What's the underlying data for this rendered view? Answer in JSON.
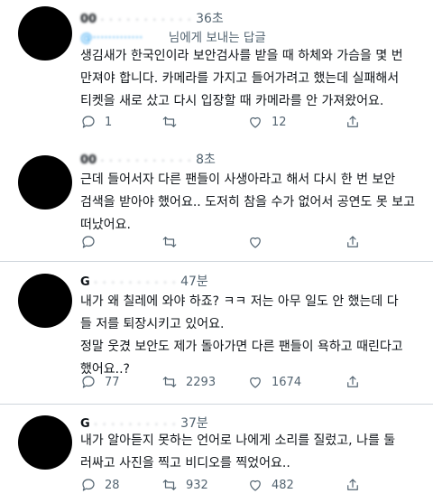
{
  "tweets": [
    {
      "handle_blurred": "@",
      "time": "36초",
      "reply_prefix": "@",
      "reply_text": "님에게 보내는 답글",
      "lines": [
        "생김새가 한국인이라 보안검사를 받을 때 하체와 가슴을 몇 번",
        "만져야 합니다. 카메라를 가지고 들어가려고 했는데 실패해서",
        "티켓을 새로 샀고 다시 입장할 때 카메라를 안 가져왔어요."
      ],
      "replies": "1",
      "retweets": "",
      "likes": "12",
      "icons": [
        "reply-icon",
        "retweet-icon",
        "like-icon",
        "share-icon"
      ]
    },
    {
      "handle_blurred": "",
      "time": "8초",
      "lines": [
        "근데 들어서자 다른 팬들이 사생아라고 해서 다시 한 번 보안",
        "검색을 받아야 했어요.. 도저히 참을 수가 없어서 공연도 못 보고",
        "떠났어요."
      ],
      "replies": "",
      "retweets": "",
      "likes": "",
      "icons": [
        "reply-icon",
        "retweet-icon",
        "like-icon",
        "share-icon"
      ]
    },
    {
      "handle_blurred": "G",
      "time": "47분",
      "lines": [
        "내가 왜 칠레에 와야 하죠? ㅋㅋ 저는 아무 일도 안 했는데 다",
        "들 저를 퇴장시키고 있어요.",
        "정말 웃겼 보안도 제가 돌아가면 다른 팬들이 욕하고 때린다고",
        "했어요..?"
      ],
      "replies": "77",
      "retweets": "2293",
      "likes": "1674",
      "icons": [
        "reply-icon",
        "retweet-icon",
        "like-icon",
        "share-icon"
      ]
    },
    {
      "handle_blurred": "G",
      "time": "37분",
      "lines": [
        "내가 알아듣지 못하는 언어로 나에게 소리를 질렀고, 나를 둘",
        "러싸고 사진을 찍고 비디오를 찍었어요.."
      ],
      "replies": "28",
      "retweets": "932",
      "likes": "482",
      "icons": [
        "reply-icon",
        "retweet-icon",
        "like-icon",
        "share-icon"
      ]
    }
  ]
}
